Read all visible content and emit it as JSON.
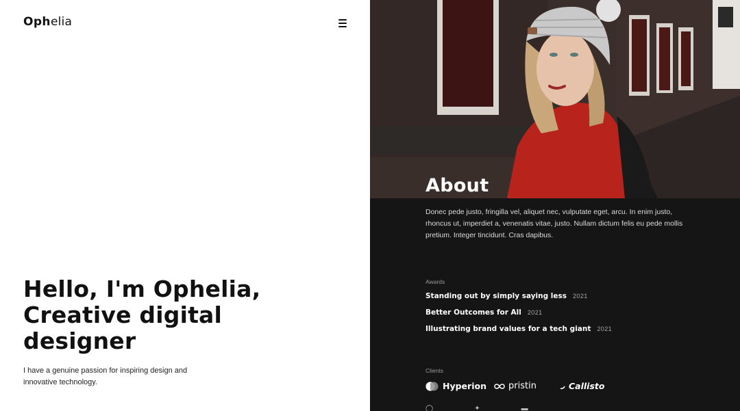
{
  "brand": {
    "bold": "Oph",
    "light": "elia"
  },
  "menu": {
    "icon": "hamburger-icon"
  },
  "hero": {
    "line1": "Hello, I'm Ophelia,",
    "line2": "Creative digital",
    "line3": "designer",
    "subtitle": "I have a genuine passion for inspiring design and innovative technology."
  },
  "about": {
    "title": "About",
    "text": "Donec pede justo, fringilla vel, aliquet nec, vulputate eget, arcu. In enim justo, rhoncus ut, imperdiet a, venenatis vitae, justo. Nullam dictum felis eu pede mollis pretium. Integer tincidunt. Cras dapibus."
  },
  "awards": {
    "label": "Awards",
    "items": [
      {
        "title": "Standing out by simply saying less",
        "year": "2021"
      },
      {
        "title": "Better Outcomes for All",
        "year": "2021"
      },
      {
        "title": "Illustrating brand values for a tech giant",
        "year": "2021"
      }
    ]
  },
  "clients": {
    "label": "Clients",
    "items": [
      {
        "name": "Hyperion",
        "icon": "half-circle-logo-icon"
      },
      {
        "name": "pristin",
        "icon": "infinity-logo-icon"
      },
      {
        "name": "Callisto",
        "icon": "c-swoosh-logo-icon"
      }
    ]
  },
  "colors": {
    "dark_panel": "#151515",
    "text_dark": "#111111",
    "accent_red": "#b8241c"
  }
}
